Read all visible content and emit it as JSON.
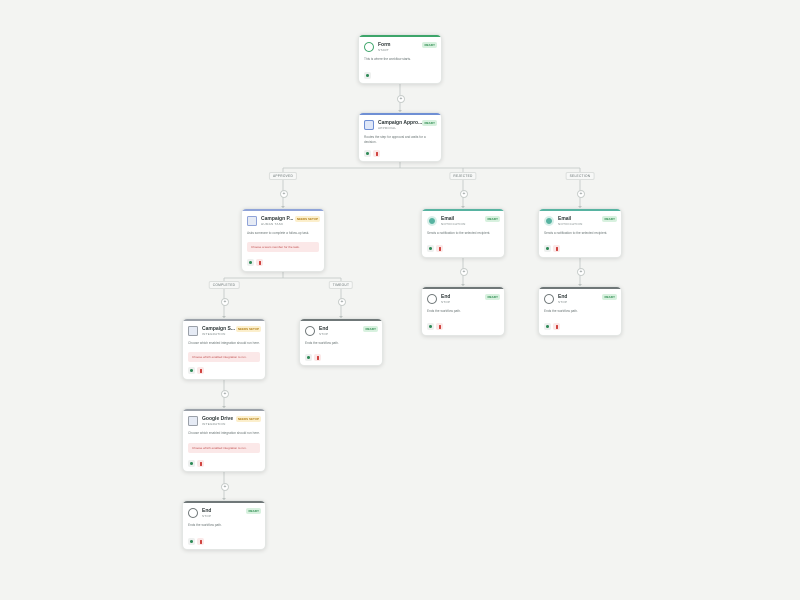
{
  "colors": {
    "trigger": "#3da56a",
    "approval": "#6f8fd4",
    "task": "#8fa3d8",
    "notification": "#57b3a1",
    "integration": "#9aa0a8",
    "end": "#6f7778",
    "ready": "#27894a",
    "setup": "#b07c11",
    "danger": "#d0433f"
  },
  "nodes": [
    {
      "id": "form",
      "title": "Form",
      "subtitle": "START",
      "badge": "READY",
      "badge_type": "ready",
      "description": "This is where the workflow starts.",
      "warning": "",
      "icon": "circle-icon",
      "kind": "trigger",
      "actions": [
        "gear"
      ]
    },
    {
      "id": "approval",
      "title": "Campaign Appro...",
      "subtitle": "APPROVAL",
      "badge": "READY",
      "badge_type": "ready",
      "description": "Routes the step for approval and waits for a decision.",
      "warning": "",
      "icon": "approval-icon",
      "kind": "approval",
      "actions": [
        "gear",
        "delete"
      ]
    },
    {
      "id": "task",
      "title": "Campaign P...",
      "subtitle": "HUMAN TASK",
      "badge": "NEEDS SETUP",
      "badge_type": "setup",
      "description": "Asks someone to complete a follow-up task.",
      "warning": "Choose a team member for the task.",
      "icon": "task-icon",
      "kind": "task",
      "actions": [
        "gear",
        "delete"
      ]
    },
    {
      "id": "email1",
      "title": "Email",
      "subtitle": "NOTIFICATION",
      "badge": "READY",
      "badge_type": "ready",
      "description": "Sends a notification to the selected recipient.",
      "warning": "",
      "icon": "email-icon",
      "kind": "notification",
      "actions": [
        "gear",
        "delete"
      ]
    },
    {
      "id": "email2",
      "title": "Email",
      "subtitle": "NOTIFICATION",
      "badge": "READY",
      "badge_type": "ready",
      "description": "Sends a notification to the selected recipient.",
      "warning": "",
      "icon": "email-icon",
      "kind": "notification",
      "actions": [
        "gear",
        "delete"
      ]
    },
    {
      "id": "end_e1",
      "title": "End",
      "subtitle": "STOP",
      "badge": "READY",
      "badge_type": "ready",
      "description": "Ends the workflow path.",
      "warning": "",
      "icon": "end-icon",
      "kind": "end",
      "actions": [
        "gear",
        "delete"
      ]
    },
    {
      "id": "end_e2",
      "title": "End",
      "subtitle": "STOP",
      "badge": "READY",
      "badge_type": "ready",
      "description": "Ends the workflow path.",
      "warning": "",
      "icon": "end-icon",
      "kind": "end",
      "actions": [
        "gear",
        "delete"
      ]
    },
    {
      "id": "sheet",
      "title": "Campaign S...",
      "subtitle": "INTEGRATION",
      "badge": "NEEDS SETUP",
      "badge_type": "setup",
      "description": "Choose which enabled integration should run here.",
      "warning": "Choose which enabled integration to run.",
      "icon": "document-icon",
      "kind": "integration",
      "actions": [
        "gear",
        "delete"
      ]
    },
    {
      "id": "end_timeout",
      "title": "End",
      "subtitle": "STOP",
      "badge": "READY",
      "badge_type": "ready",
      "description": "Ends the workflow path.",
      "warning": "",
      "icon": "end-icon",
      "kind": "end",
      "actions": [
        "gear",
        "delete"
      ]
    },
    {
      "id": "gdrive",
      "title": "Google Drive",
      "subtitle": "INTEGRATION",
      "badge": "NEEDS SETUP",
      "badge_type": "setup",
      "description": "Choose which enabled integration should run here.",
      "warning": "Choose which enabled integration to run.",
      "icon": "document-icon",
      "kind": "integration",
      "actions": [
        "gear",
        "delete"
      ]
    },
    {
      "id": "end_final",
      "title": "End",
      "subtitle": "STOP",
      "badge": "READY",
      "badge_type": "ready",
      "description": "Ends the workflow path.",
      "warning": "",
      "icon": "end-icon",
      "kind": "end",
      "actions": [
        "gear",
        "delete"
      ]
    }
  ],
  "edge_labels": {
    "approved": "APPROVED",
    "rejected": "REJECTED",
    "selection": "SELECTION",
    "completed": "COMPLETED",
    "timeout": "TIMEOUT"
  },
  "add_step_symbol": "+"
}
